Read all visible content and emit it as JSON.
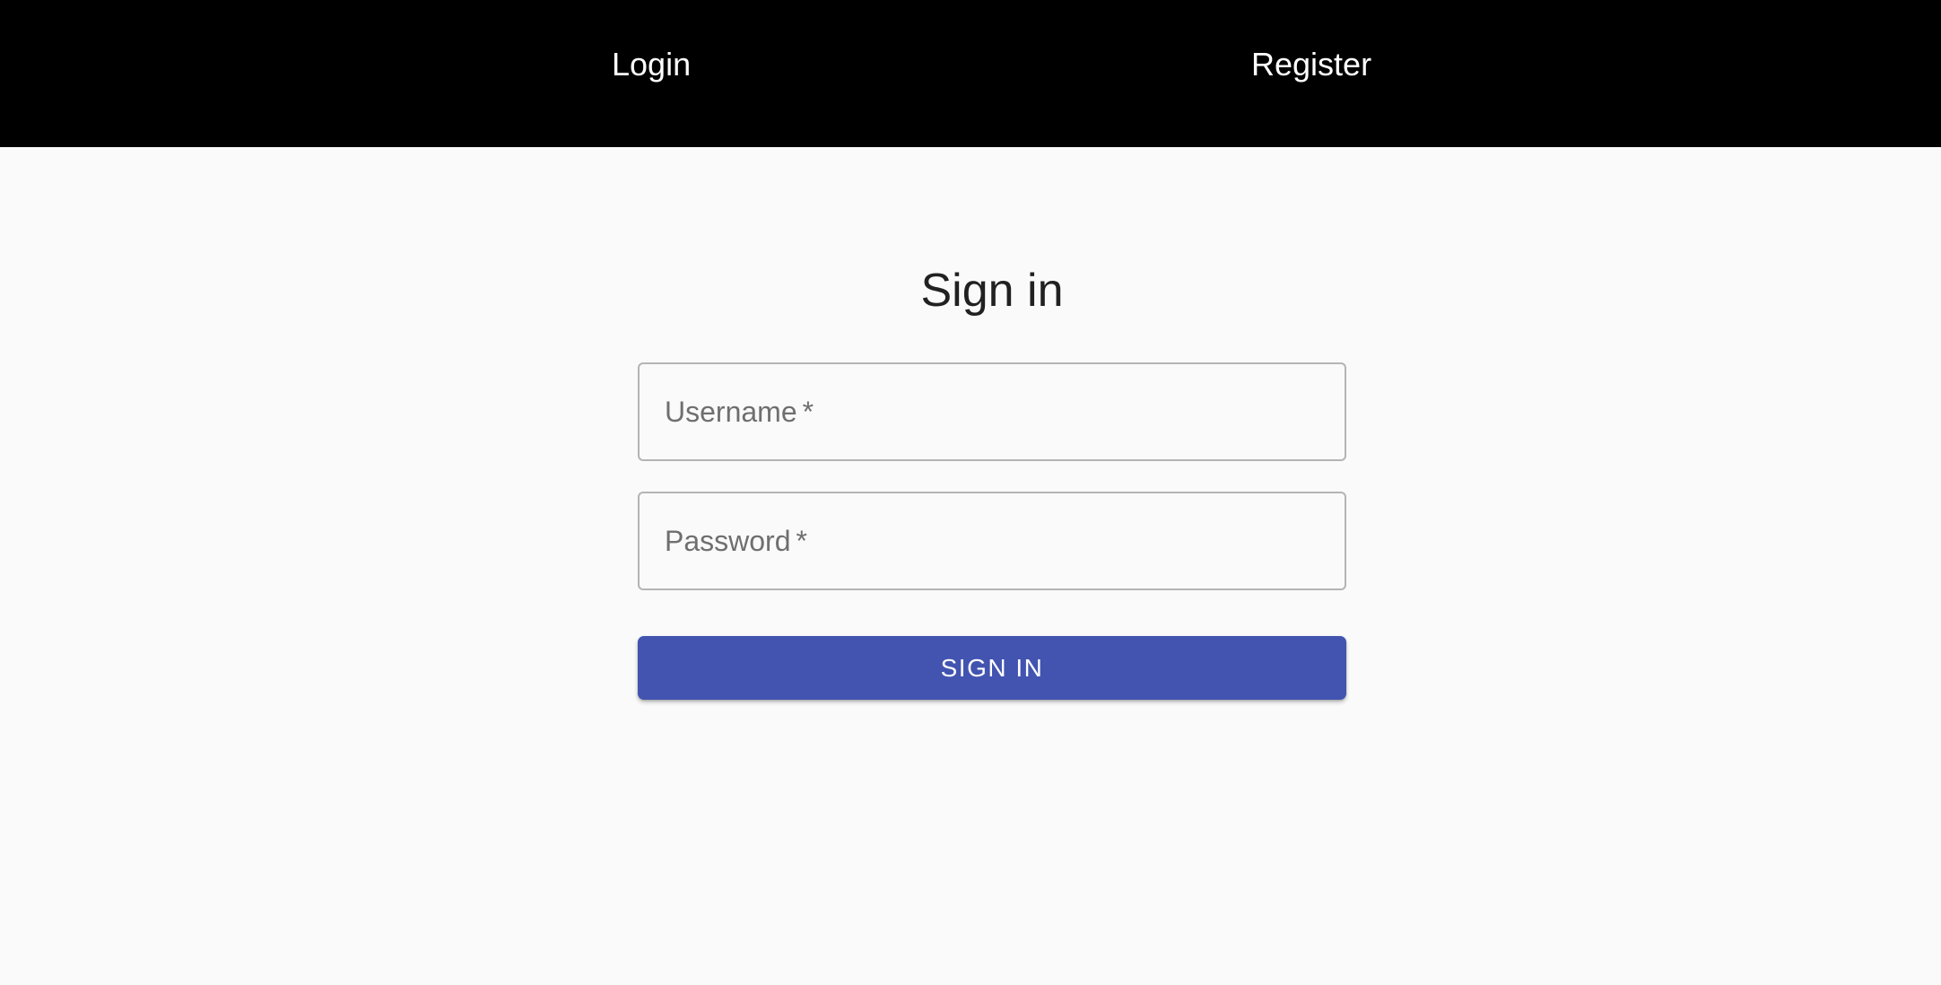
{
  "nav": {
    "login_label": "Login",
    "register_label": "Register"
  },
  "form": {
    "title": "Sign in",
    "username": {
      "label": "Username",
      "required_marker": "*",
      "value": ""
    },
    "password": {
      "label": "Password",
      "required_marker": "*",
      "value": ""
    },
    "submit_label": "SIGN IN"
  },
  "colors": {
    "header_background": "#000000",
    "page_background": "#fafafa",
    "primary_button": "#4254b0",
    "field_border": "#b4b4b4",
    "label_text": "#6f6f6f",
    "title_text": "#212121"
  }
}
